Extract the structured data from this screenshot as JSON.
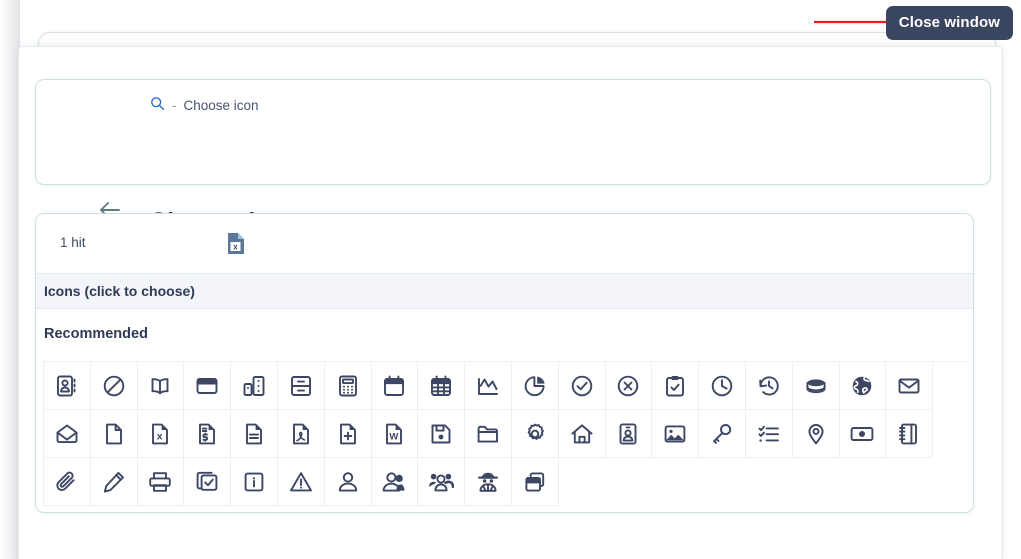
{
  "tooltip": {
    "label": "Close window",
    "bg": "#3a4660",
    "arrow_color": "#ee1c1c"
  },
  "header": {
    "breadcrumb": {
      "icon": "search-icon",
      "separator": "-",
      "label": "Choose icon"
    },
    "back_icon": "arrow-left-icon",
    "title": "Choose icon"
  },
  "results": {
    "hits_label": "1 hit",
    "export_icon": "excel-file-icon",
    "band_title": "Icons (click to choose)",
    "group_title": "Recommended"
  },
  "icon_grid": {
    "rows": [
      [
        "address-book-icon",
        "ban-icon",
        "book-open-icon",
        "browser-window-icon",
        "buildings-icon",
        "archive-cabinet-icon",
        "calculator-icon",
        "calendar-icon",
        "calendar-grid-icon",
        "chart-line-icon",
        "chart-pie-icon",
        "check-circle-icon",
        "x-circle-icon",
        "clipboard-check-icon",
        "clock-icon",
        "clock-history-icon",
        "coins-icon",
        "globe-icon",
        "envelope-icon",
        "envelope-open-icon"
      ],
      [
        "file-icon",
        "file-excel-icon",
        "file-invoice-icon",
        "file-text-icon",
        "file-pdf-icon",
        "file-plus-icon",
        "file-word-icon",
        "floppy-disk-icon",
        "folder-icon",
        "gear-icon",
        "home-icon",
        "id-card-icon",
        "image-icon",
        "key-icon",
        "list-check-icon",
        "map-pin-icon",
        "money-bill-icon",
        "notebook-icon",
        "paperclip-icon",
        "pencil-icon"
      ],
      [
        "printer-icon",
        "copy-check-icon",
        "info-square-icon",
        "warning-triangle-icon",
        "user-icon",
        "users-two-icon",
        "users-group-icon",
        "user-secret-icon",
        "copy-windows-icon"
      ]
    ]
  },
  "colors": {
    "icon_stroke": "#3d4663",
    "card_border": "#cfe0e2",
    "band_bg": "#f3f5fa",
    "title": "#2e3a52",
    "breadcrumb_search": "#2f6fd0",
    "back_arrow": "#5b7c80"
  }
}
